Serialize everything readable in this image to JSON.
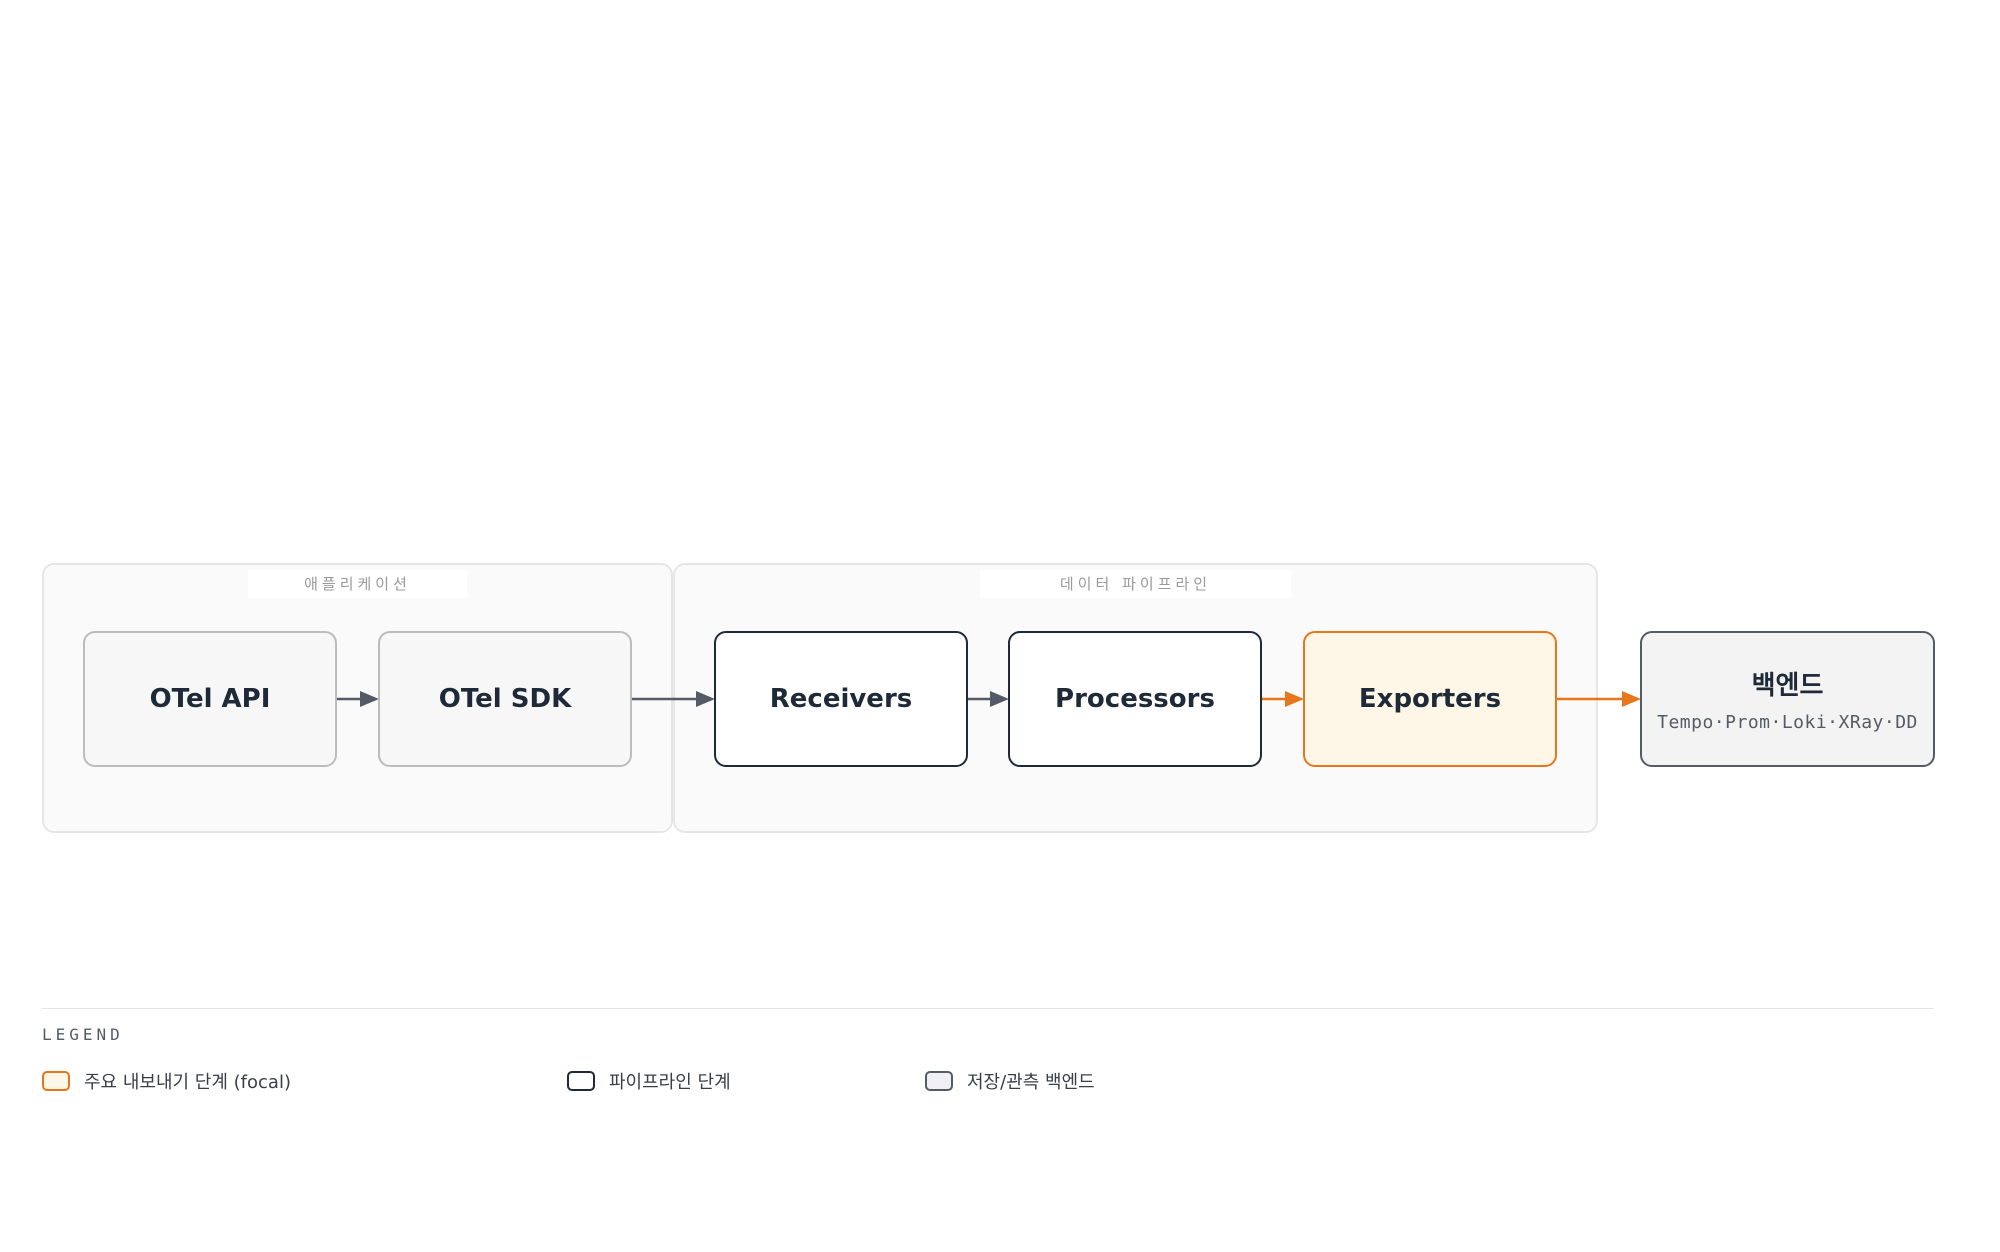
{
  "groups": {
    "application": {
      "label": "애플리케이션"
    },
    "pipeline": {
      "label": "데이터 파이프라인"
    }
  },
  "nodes": {
    "otel_api": {
      "title": "OTel API"
    },
    "otel_sdk": {
      "title": "OTel SDK"
    },
    "receivers": {
      "title": "Receivers"
    },
    "processors": {
      "title": "Processors"
    },
    "exporters": {
      "title": "Exporters"
    },
    "backend": {
      "title": "백엔드",
      "subtitle": "Tempo·Prom·Loki·XRay·DD"
    }
  },
  "legend": {
    "title": "LEGEND",
    "items": [
      {
        "label": "주요 내보내기 단계 (focal)"
      },
      {
        "label": "파이프라인 단계"
      },
      {
        "label": "저장/관측 백엔드"
      }
    ]
  },
  "colors": {
    "focal": "#e8761c",
    "focal_fill": "#fef6e6",
    "ink": "#1e2a38",
    "edge": "#555b66"
  }
}
